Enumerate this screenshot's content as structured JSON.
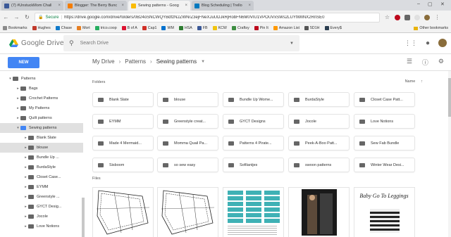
{
  "browser": {
    "tabs": [
      {
        "label": "(7) #UnstuckMom Chall",
        "color": "#3b5998",
        "active": false
      },
      {
        "label": "Blogger: The Berry Bunc",
        "color": "#f57d00",
        "active": false
      },
      {
        "label": "Sewing patterns - Goog",
        "color": "#fbbc05",
        "active": true
      },
      {
        "label": "Blog Scheduling | Trello",
        "color": "#0079bf",
        "active": false
      }
    ],
    "secure_label": "Secure",
    "url": "https://drive.google.com/drive/folders/0B24oSNCWQYBdfzN2ZWNrZ3ejFNeXJuUDJkRjRobFN6M0VIU1VPOUVxSWs2LUYtWllNX2RnSE0",
    "bookmarks": [
      "Bookmarks",
      "Hughes",
      "Chase",
      "Mort",
      "trico.coop",
      "B of A",
      "Cap1",
      "WM",
      "HSA",
      "FB",
      "KCW",
      "Craftsy",
      "Pin It",
      "Amazon List",
      "5D1H",
      "Every$"
    ],
    "other_bookmarks": "Other bookmarks"
  },
  "header": {
    "logo_text": "Google Drive",
    "search_placeholder": "Search Drive"
  },
  "toolbar": {
    "new_label": "NEW",
    "breadcrumb": [
      "My Drive",
      "Patterns",
      "Sewing patterns"
    ]
  },
  "sidebar": {
    "items": [
      {
        "label": "Patterns",
        "arrow": "▾",
        "indent": 1,
        "blue": false,
        "hl": false
      },
      {
        "label": "Bags",
        "arrow": "▸",
        "indent": 2,
        "blue": false,
        "hl": false
      },
      {
        "label": "Crochet Patterns",
        "arrow": "▸",
        "indent": 2,
        "blue": false,
        "hl": false
      },
      {
        "label": "My Patterns",
        "arrow": "▸",
        "indent": 2,
        "blue": false,
        "hl": false
      },
      {
        "label": "Quilt patterns",
        "arrow": "▸",
        "indent": 2,
        "blue": false,
        "hl": false
      },
      {
        "label": "Sewing patterns",
        "arrow": "▾",
        "indent": 2,
        "blue": true,
        "hl": true
      },
      {
        "label": "Blank Slate",
        "arrow": "▸",
        "indent": 3,
        "blue": false,
        "hl": false
      },
      {
        "label": "blouse",
        "arrow": "▸",
        "indent": 3,
        "blue": false,
        "hl": true
      },
      {
        "label": "Bundle Up ...",
        "arrow": "▸",
        "indent": 3,
        "blue": false,
        "hl": false
      },
      {
        "label": "BurdaStyle",
        "arrow": "▸",
        "indent": 3,
        "blue": false,
        "hl": false
      },
      {
        "label": "Closet Case...",
        "arrow": "▸",
        "indent": 3,
        "blue": false,
        "hl": false
      },
      {
        "label": "EYMM",
        "arrow": "▸",
        "indent": 3,
        "blue": false,
        "hl": false
      },
      {
        "label": "Greenstyle ...",
        "arrow": "▸",
        "indent": 3,
        "blue": false,
        "hl": false
      },
      {
        "label": "GYCT Desig...",
        "arrow": "▸",
        "indent": 3,
        "blue": false,
        "hl": false
      },
      {
        "label": "Jocole",
        "arrow": "▸",
        "indent": 3,
        "blue": false,
        "hl": false
      },
      {
        "label": "Love Notions",
        "arrow": "▸",
        "indent": 3,
        "blue": false,
        "hl": false
      }
    ]
  },
  "main": {
    "folders_label": "Folders",
    "files_label": "Files",
    "sort_label": "Name",
    "folders": [
      "Blank Slate",
      "blouse",
      "Bundle Up Wome...",
      "BurdaStyle",
      "Closet Case Patt...",
      "EYMM",
      "Greenstyle creat...",
      "GYCT Designs",
      "Jocole",
      "Love Notions",
      "Made 4 Mermaid...",
      "Momma Quail Pa...",
      "Patterns 4 Pirate...",
      "Peek-A-Boo Patt...",
      "Sew Fab Bundle",
      "Sisboom",
      "so sew easy",
      "Sofilantjes",
      "swoon patterns",
      "Winter Wear Desi..."
    ],
    "files": [
      {
        "kind": "pattern-sheet"
      },
      {
        "kind": "pattern-sheet"
      },
      {
        "kind": "teal-doc"
      },
      {
        "kind": "photo"
      },
      {
        "kind": "leggings",
        "title": "Baby Go To Leggings"
      }
    ]
  }
}
